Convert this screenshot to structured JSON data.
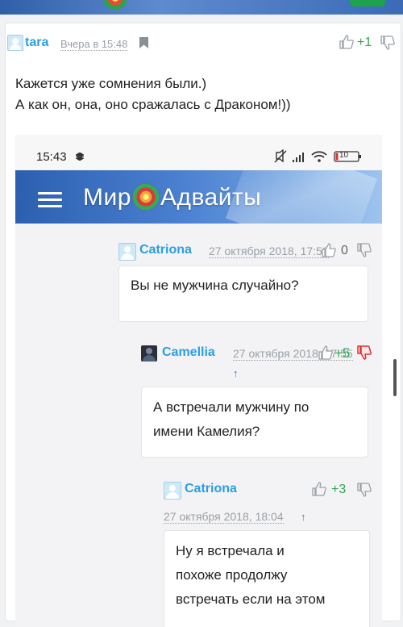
{
  "comment": {
    "author": "tara",
    "time": "Вчера в 15:48",
    "votes": "+1",
    "text_line1": "Кажется уже сомнения были.)",
    "text_line2": "А как он, она, оно сражалась с Драконом!))"
  },
  "screenshot": {
    "status_time": "15:43",
    "battery": "10",
    "site_logo_left": "Мир",
    "site_logo_right": "Адвайты",
    "replies": [
      {
        "author": "Catriona",
        "time": "27 октября 2018, 17:59",
        "votes": "0",
        "text": "Вы не мужчина случайно?"
      },
      {
        "author": "Camellia",
        "time": "27 октября 2018, 17:55",
        "votes": "+5",
        "parent_link": "↑",
        "text_line1": "А встречали мужчину по",
        "text_line2": "имени Камелия?"
      },
      {
        "author": "Catriona",
        "time": "27 октября 2018, 18:04",
        "votes": "+3",
        "parent_link": "↑",
        "text_line1": "Ну я встречала и",
        "text_line2": "похоже продолжу",
        "text_line3": "встречать если на этом"
      }
    ]
  },
  "colors": {
    "username": "#2a9fe0",
    "positive": "#2fa84f",
    "negative": "#e0312f",
    "site_header": "#2c5fb0"
  }
}
